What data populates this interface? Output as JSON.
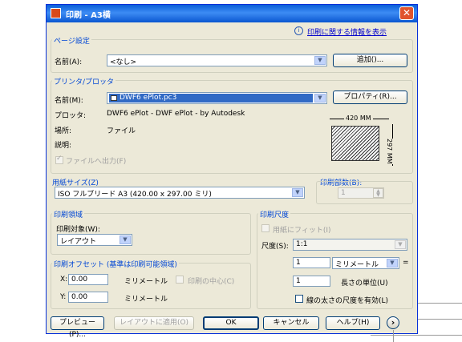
{
  "window": {
    "title": "印刷 - A3横",
    "close": "✕"
  },
  "help_link": {
    "text": "印刷に関する情報を表示"
  },
  "page_setup": {
    "title": "ページ設定",
    "name_label": "名前(A):",
    "name_value": "<なし>",
    "add_button": "追加()..."
  },
  "printer": {
    "title": "プリンタ/プロッタ",
    "name_label": "名前(M):",
    "name_value": "DWF6 ePlot.pc3",
    "properties_button": "プロパティ(R)...",
    "plotter_label": "プロッタ:",
    "plotter_value": "DWF6 ePlot - DWF ePlot - by Autodesk",
    "location_label": "場所:",
    "location_value": "ファイル",
    "description_label": "説明:",
    "print_to_file_label": "ファイルへ出力(F)",
    "preview_width": "420 MM",
    "preview_height": "297 MM"
  },
  "paper_size": {
    "title": "用紙サイズ(Z)",
    "value": "ISO フルブリード A3 (420.00 x 297.00 ミリ)"
  },
  "copies": {
    "title": "印刷部数(B):",
    "value": "1"
  },
  "plot_area": {
    "title": "印刷領域",
    "what_label": "印刷対象(W):",
    "what_value": "レイアウト"
  },
  "plot_scale": {
    "title": "印刷尺度",
    "fit_label": "用紙にフィット(I)",
    "scale_label": "尺度(S):",
    "scale_value": "1:1",
    "value1": "1",
    "unit_value": "ミリメートル",
    "equals": "=",
    "value2": "1",
    "unit_label": "長さの単位(U)",
    "lineweight_label": "線の太さの尺度を有効(L)"
  },
  "plot_offset": {
    "title": "印刷オフセット (基準は印刷可能領域)",
    "x_label": "X:",
    "x_value": "0.00",
    "x_unit": "ミリメートル",
    "center_label": "印刷の中心(C)",
    "y_label": "Y:",
    "y_value": "0.00",
    "y_unit": "ミリメートル"
  },
  "buttons": {
    "preview": "プレビュー(P)...",
    "apply": "レイアウトに適用(O)",
    "ok": "OK",
    "cancel": "キャンセル",
    "help": "ヘルプ(H)",
    "expand": "›"
  }
}
